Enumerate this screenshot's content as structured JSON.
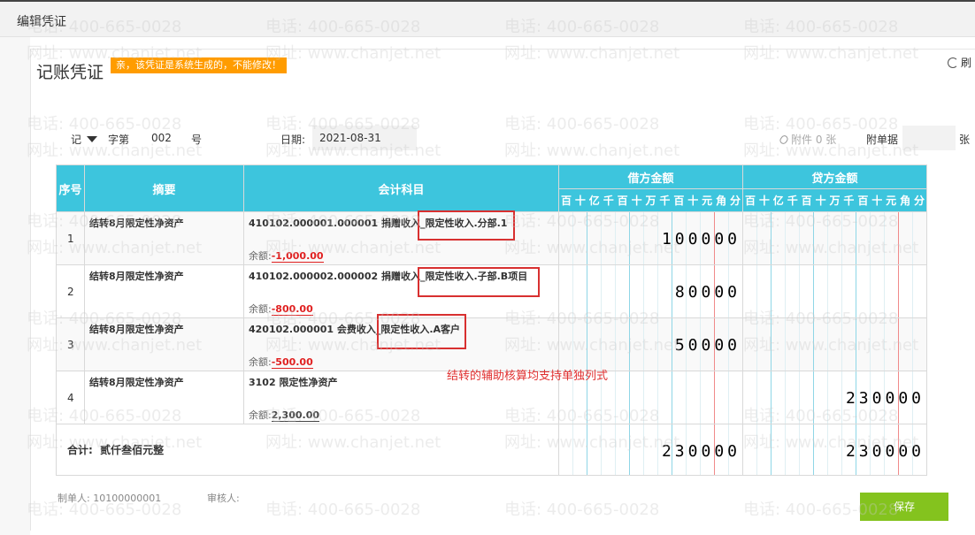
{
  "window": {
    "title": "编辑凭证"
  },
  "voucher": {
    "title": "记账凭证",
    "notice": "亲，该凭证是系统生成的，不能修改！",
    "refresh_label": "刷",
    "type": "记",
    "no_prefix": "字第",
    "no": "002",
    "no_suffix": "号",
    "date_label": "日期:",
    "date": "2021-08-31",
    "attach_label": "附件 0 张",
    "docs_label": "附单据",
    "docs_unit": "张"
  },
  "table": {
    "headers": {
      "seq": "序号",
      "summary": "摘要",
      "account": "会计科目",
      "debit": "借方金额",
      "credit": "贷方金额"
    },
    "digits": [
      "百",
      "十",
      "亿",
      "千",
      "百",
      "十",
      "万",
      "千",
      "百",
      "十",
      "元",
      "角",
      "分"
    ],
    "balance_label": "余额:",
    "rows": [
      {
        "seq": "1",
        "summary": "结转8月限定性净资产",
        "account": "410102.000001.000001 捐赠收入_限定性收入.分部.1",
        "balance": "-1,000.00",
        "debit": "100000",
        "credit": ""
      },
      {
        "seq": "2",
        "summary": "结转8月限定性净资产",
        "account": "410102.000002.000002 捐赠收入_限定性收入.子部.B项目",
        "balance": "-800.00",
        "debit": "80000",
        "credit": ""
      },
      {
        "seq": "3",
        "summary": "结转8月限定性净资产",
        "account": "420102.000001 会费收入_限定性收入.A客户",
        "balance": "-500.00",
        "debit": "50000",
        "credit": ""
      },
      {
        "seq": "4",
        "summary": "结转8月限定性净资产",
        "account": "3102 限定性净资产",
        "balance": "2,300.00",
        "debit": "",
        "credit": "230000"
      }
    ],
    "total": {
      "label": "合计:",
      "words": "贰仟叁佰元整",
      "debit": "230000",
      "credit": "230000"
    }
  },
  "annotation": "结转的辅助核算均支持单独列式",
  "footer": {
    "maker_label": "制单人:",
    "maker": "10100000001",
    "reviewer_label": "审核人:"
  },
  "save_label": "保存",
  "watermark": {
    "phone": "电话: 400-665-0028",
    "site": "网址: www.chanjet.net"
  },
  "colors": {
    "header": "#3dc5dd",
    "notice": "#ff9c00",
    "save": "#84c31e",
    "negative": "#e02020"
  }
}
